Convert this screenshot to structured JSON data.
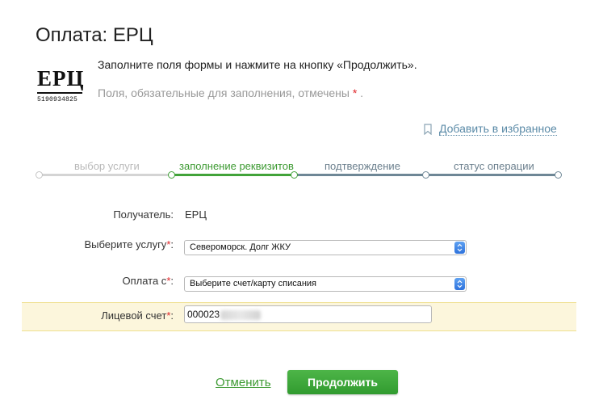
{
  "page": {
    "title": "Оплата: ЕРЦ"
  },
  "logo": {
    "text": "ЕРЦ",
    "number": "5190934825"
  },
  "info": {
    "instruction": "Заполните поля формы и нажмите на кнопку «Продолжить».",
    "required_note": "Поля, обязательные для заполнения, отмечены",
    "required_star": "*",
    "required_end": "."
  },
  "favorite": {
    "label": "Добавить в избранное",
    "icon": "bookmark-icon"
  },
  "steps": [
    {
      "label": "выбор услуги",
      "state": "done"
    },
    {
      "label": "заполнение реквизитов",
      "state": "active"
    },
    {
      "label": "подтверждение",
      "state": "pending"
    },
    {
      "label": "статус операции",
      "state": "pending"
    }
  ],
  "form": {
    "recipient_label": "Получатель:",
    "recipient_value": "ЕРЦ",
    "service_label": "Выберите услугу",
    "service_value": "Североморск. Долг ЖКУ",
    "payfrom_label": "Оплата с",
    "payfrom_value": "Выберите счет/карту списания",
    "account_label": "Лицевой счет",
    "account_value": "000023",
    "required_star": "*",
    "colon": ":"
  },
  "buttons": {
    "cancel": "Отменить",
    "continue": "Продолжить"
  },
  "colors": {
    "accent_green": "#3d9a32",
    "link_blue": "#5a8aa7",
    "required_red": "#e0262a",
    "highlight": "#fcf6dc"
  }
}
